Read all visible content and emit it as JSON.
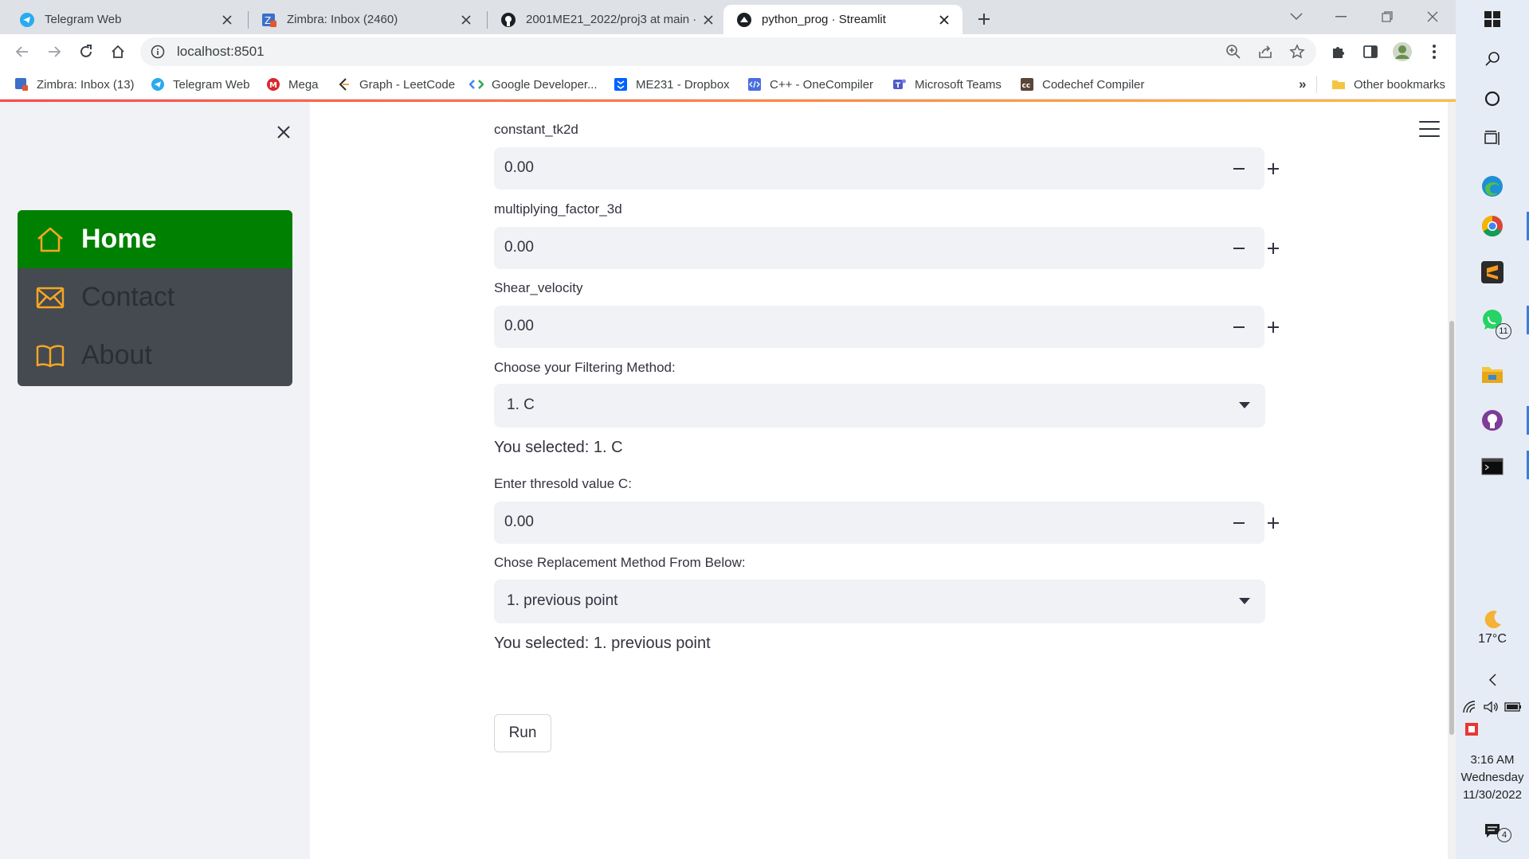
{
  "browser": {
    "tabs": [
      {
        "title": "Telegram Web",
        "icon": "telegram-icon",
        "active": false
      },
      {
        "title": "Zimbra: Inbox (2460)",
        "icon": "zimbra-icon",
        "active": false
      },
      {
        "title": "2001ME21_2022/proj3 at main · ",
        "icon": "github-icon",
        "active": false
      },
      {
        "title": "python_prog · Streamlit",
        "icon": "streamlit-icon",
        "active": true
      }
    ],
    "url": "localhost:8501",
    "bookmarks": [
      {
        "label": "Zimbra: Inbox (13)",
        "icon": "zimbra-icon"
      },
      {
        "label": "Telegram Web",
        "icon": "telegram-icon"
      },
      {
        "label": "Mega",
        "icon": "mega-icon"
      },
      {
        "label": "Graph - LeetCode",
        "icon": "leetcode-icon"
      },
      {
        "label": "Google Developer...",
        "icon": "google-developers-icon"
      },
      {
        "label": "ME231 - Dropbox",
        "icon": "dropbox-icon"
      },
      {
        "label": "C++ - OneCompiler",
        "icon": "onecompiler-icon"
      },
      {
        "label": "Microsoft Teams",
        "icon": "teams-icon"
      },
      {
        "label": "Codechef Compiler",
        "icon": "codechef-icon"
      }
    ],
    "more_bookmarks": "»",
    "other_bookmarks": "Other bookmarks"
  },
  "sidebar": {
    "menu": [
      {
        "label": "Home",
        "icon": "home-icon",
        "active": true
      },
      {
        "label": "Contact",
        "icon": "envelope-icon",
        "active": false
      },
      {
        "label": "About",
        "icon": "book-icon",
        "active": false
      }
    ],
    "active_color": "#008000",
    "menu_bg": "#454950",
    "icon_color": "#f5a623"
  },
  "main": {
    "constant_tk2d": {
      "label": "constant_tk2d",
      "value": "0.00"
    },
    "multiplying_factor_3d": {
      "label": "multiplying_factor_3d",
      "value": "0.00"
    },
    "shear_velocity": {
      "label": "Shear_velocity",
      "value": "0.00"
    },
    "filter_method": {
      "label": "Choose your Filtering Method:",
      "value": "1. C"
    },
    "filter_selected": "You selected: 1. C",
    "threshold": {
      "label": "Enter thresold value C:",
      "value": "0.00"
    },
    "replacement_method": {
      "label": "Chose Replacement Method From Below:",
      "value": "1. previous point"
    },
    "replacement_selected": "You selected: 1. previous point",
    "run_label": "Run"
  },
  "taskbar": {
    "weather_temp": "17°C",
    "time": "3:16 AM",
    "day": "Wednesday",
    "date": "11/30/2022",
    "whatsapp_badge": "11",
    "notification_badge": "4"
  }
}
